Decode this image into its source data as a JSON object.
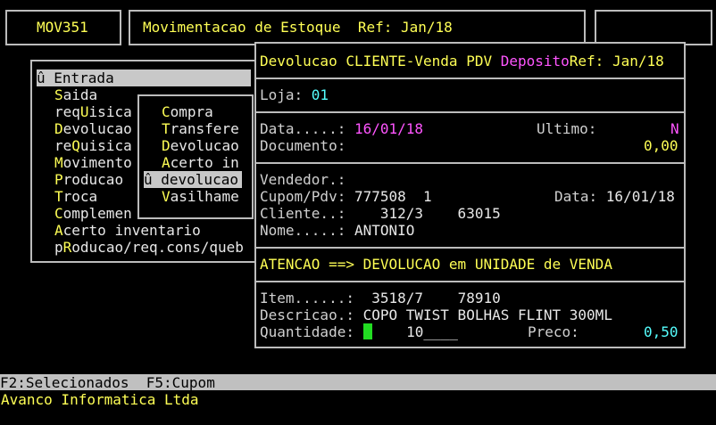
{
  "header": {
    "code": "MOV351",
    "title": "Movimentacao de Estoque  Ref: Jan/18"
  },
  "menu": {
    "items": [
      {
        "prefix": "û ",
        "text": "Entrada"
      },
      {
        "hotkey": "S",
        "rest": "aida"
      },
      {
        "pre": "req",
        "hotkey": "U",
        "rest": "isica"
      },
      {
        "hotkey": "D",
        "rest": "evolucao"
      },
      {
        "pre": "re",
        "hotkey": "Q",
        "rest": "uisica"
      },
      {
        "hotkey": "M",
        "rest": "ovimento"
      },
      {
        "hotkey": "P",
        "rest": "roducao"
      },
      {
        "hotkey": "T",
        "rest": "roca"
      },
      {
        "hotkey": "C",
        "rest": "omplemen"
      },
      {
        "hotkey": "A",
        "rest": "certo inventario"
      },
      {
        "pre": "p",
        "hotkey": "R",
        "rest": "oducao/req.cons/queb"
      }
    ]
  },
  "submenu": {
    "items": [
      {
        "hotkey": "C",
        "rest": "ompra"
      },
      {
        "hotkey": "T",
        "rest": "ransfere"
      },
      {
        "hotkey": "D",
        "rest": "evolucao"
      },
      {
        "hotkey": "A",
        "rest": "certo in"
      },
      {
        "text": "û devolucao"
      },
      {
        "hotkey": "V",
        "rest": "asilhame"
      }
    ]
  },
  "dialog": {
    "title_a": "Devolucao CLIENTE-Venda PDV ",
    "title_b": "Deposito",
    "title_c": "Ref: Jan/18",
    "loja_label": "Loja: ",
    "loja_value": "01",
    "data_label": "Data.....: ",
    "data_value": "16/01/18",
    "ultimo_label": "Ultimo:",
    "ultimo_value": "N",
    "documento_label": "Documento:",
    "documento_value": "0,00",
    "vendedor_label": "Vendedor.:",
    "cupom_label": "Cupom/Pdv: ",
    "cupom_value": "777508  1",
    "cupom_data_label": "Data: ",
    "cupom_data_value": "16/01/18",
    "cliente_label": "Cliente..:",
    "cliente_value": "    312/3    63015",
    "nome_label": "Nome.....: ",
    "nome_value": "ANTONIO",
    "warning": "ATENCAO ==> DEVOLUCAO em UNIDADE de VENDA",
    "item_label": "Item......:",
    "item_value": "  3518/7    78910",
    "descricao_label": "Descricao.: ",
    "descricao_value": "COPO TWIST BOLHAS FLINT 300ML",
    "quantidade_label": "Quantidade: ",
    "quantidade_value": "    10____",
    "preco_label": "Preco:",
    "preco_value": "0,50"
  },
  "statusbar": {
    "keys": "F2:Selecionados  F5:Cupom"
  },
  "footer": {
    "company": "Avanco Informatica Ltda"
  },
  "colors": {
    "background": "#000000",
    "label": "#d0d0d0",
    "highlight": "#ffff55",
    "magenta": "#ff55ff",
    "cyan": "#55ffff",
    "cursor": "#22dd22"
  }
}
